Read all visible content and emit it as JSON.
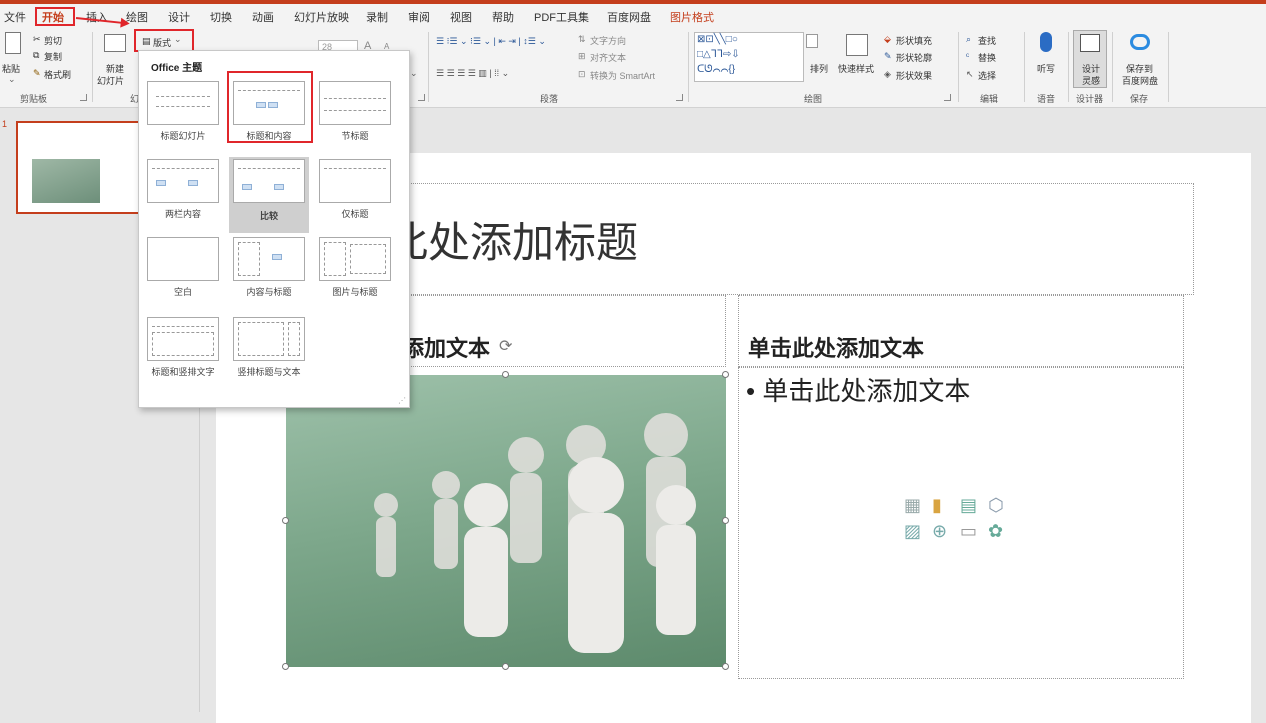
{
  "tabs": [
    "文件",
    "开始",
    "插入",
    "绘图",
    "设计",
    "切换",
    "动画",
    "幻灯片放映",
    "录制",
    "审阅",
    "视图",
    "帮助",
    "PDF工具集",
    "百度网盘",
    "图片格式"
  ],
  "clipboard": {
    "paste": "粘贴",
    "cut": "剪切",
    "copy": "复制",
    "format_painter": "格式刷",
    "group": "剪贴板"
  },
  "slides": {
    "new_slide": "新建",
    "new_slide2": "幻灯片",
    "layout": "版式",
    "group_partial": "幻"
  },
  "font": {
    "size": "28",
    "grow": "A",
    "shrink": "A"
  },
  "paragraph": {
    "text_direction": "文字方向",
    "align_text": "对齐文本",
    "smartart": "转换为 SmartArt",
    "group": "段落"
  },
  "drawing": {
    "arrange": "排列",
    "quick_styles": "快速样式",
    "fill": "形状填充",
    "outline": "形状轮廓",
    "effects": "形状效果",
    "group": "绘图"
  },
  "editing": {
    "find": "查找",
    "replace": "替换",
    "select": "选择",
    "group": "编辑"
  },
  "voice": {
    "dictate": "听写",
    "group": "语音"
  },
  "designer": {
    "design_ideas": "设计",
    "design_ideas2": "灵感",
    "group": "设计器"
  },
  "save": {
    "save_to": "保存到",
    "save_to2": "百度网盘",
    "group": "保存"
  },
  "layout_menu": {
    "heading": "Office 主题",
    "items": [
      "标题幻灯片",
      "标题和内容",
      "节标题",
      "两栏内容",
      "比较",
      "仅标题",
      "空白",
      "内容与标题",
      "图片与标题",
      "标题和竖排文字",
      "竖排标题与文本"
    ]
  },
  "thumbnail": {
    "number": "1"
  },
  "slide": {
    "title": "此处添加标题",
    "left_heading": "添加文本",
    "right_heading": "单击此处添加文本",
    "right_bullet": "单击此处添加文本"
  },
  "colors": {
    "accent": "#c43e1c",
    "highlight": "#e0262b"
  }
}
